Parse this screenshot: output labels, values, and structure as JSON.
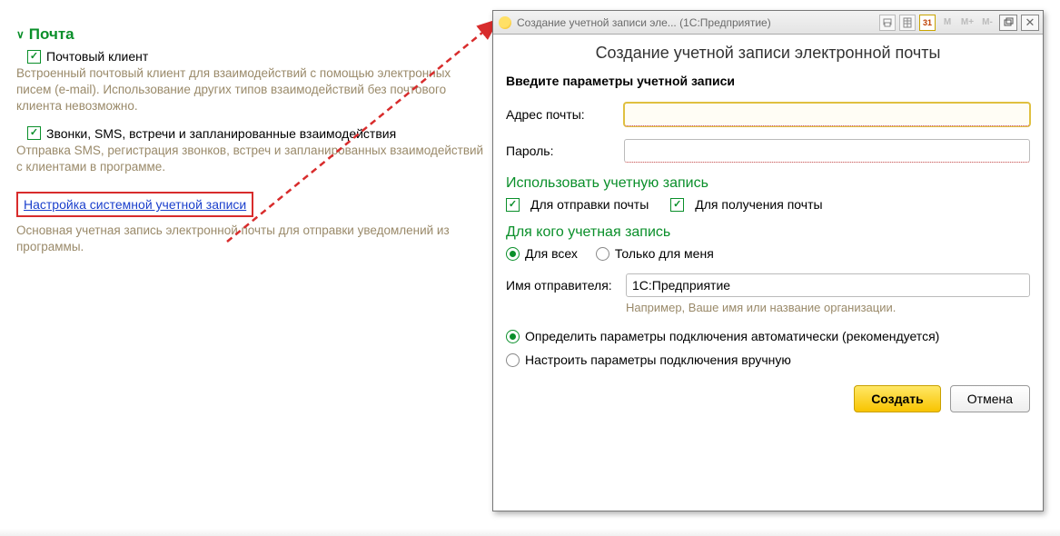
{
  "settings": {
    "section_title": "Почта",
    "mail_client_label": "Почтовый клиент",
    "mail_client_desc": "Встроенный почтовый клиент для взаимодействий с помощью электронных писем (e-mail). Использование других типов взаимодействий без почтового клиента невозможно.",
    "calls_label": "Звонки, SMS, встречи и запланированные взаимодействия",
    "calls_desc": "Отправка SMS, регистрация звонков, встреч и запланированных взаимодействий с клиентами в программе.",
    "link_label": "Настройка системной учетной записи",
    "link_desc": "Основная учетная запись электронной почты для отправки уведомлений из программы."
  },
  "dialog": {
    "titlebar_text": "Создание учетной записи эле... (1С:Предприятие)",
    "title": "Создание учетной записи электронной почты",
    "subtitle": "Введите параметры учетной записи",
    "email_label": "Адрес почты:",
    "email_value": "",
    "password_label": "Пароль:",
    "password_value": "",
    "use_header": "Использовать учетную запись",
    "use_send": "Для отправки почты",
    "use_receive": "Для получения почты",
    "whom_header": "Для кого учетная запись",
    "whom_all": "Для всех",
    "whom_me": "Только для меня",
    "sender_label": "Имя отправителя:",
    "sender_value": "1С:Предприятие",
    "sender_hint": "Например, Ваше имя или название организации.",
    "auto_label": "Определить параметры подключения автоматически (рекомендуется)",
    "manual_label": "Настроить параметры подключения вручную",
    "create_btn": "Создать",
    "cancel_btn": "Отмена"
  }
}
